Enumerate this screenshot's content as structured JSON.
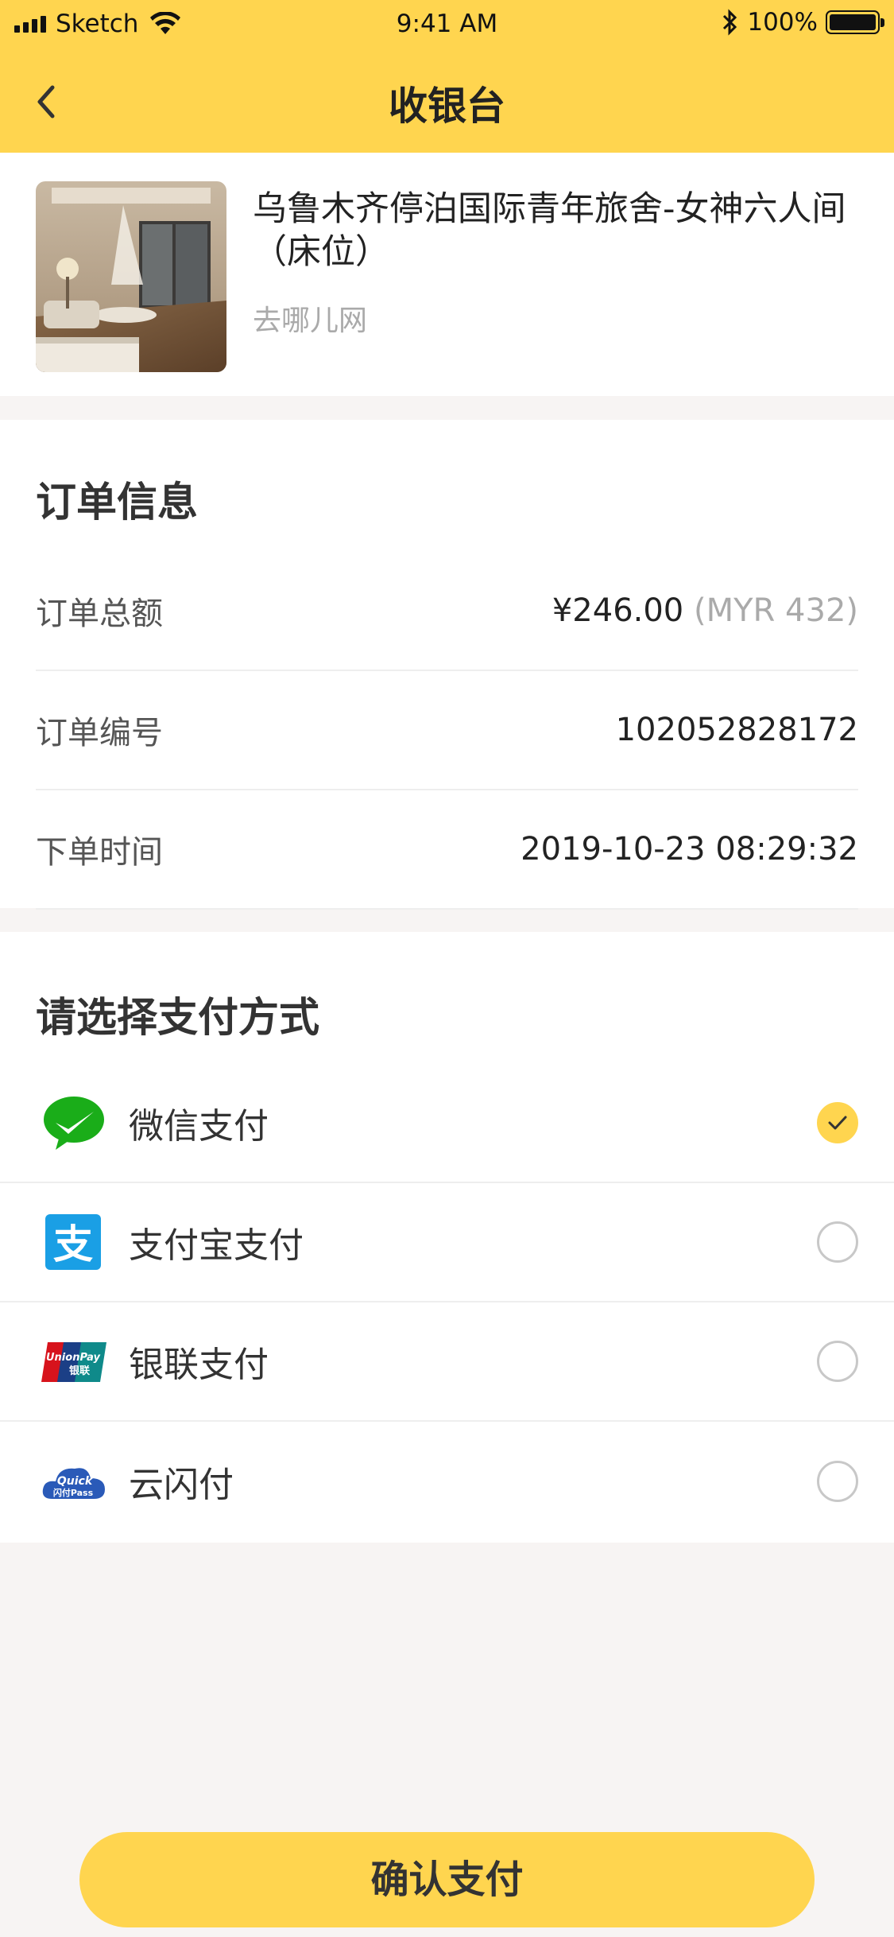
{
  "status_bar": {
    "carrier": "Sketch",
    "time": "9:41 AM",
    "battery": "100%"
  },
  "nav": {
    "title": "收银台",
    "back_icon": "chevron-left-icon"
  },
  "product": {
    "title": "乌鲁木齐停泊国际青年旅舍-女神六人间（床位）",
    "source": "去哪儿网",
    "image": "hostel-room-photo"
  },
  "order_info": {
    "title": "订单信息",
    "rows": [
      {
        "label": "订单总额",
        "value": "¥246.00",
        "sub": "(MYR 432)"
      },
      {
        "label": "订单编号",
        "value": "102052828172",
        "sub": ""
      },
      {
        "label": "下单时间",
        "value": "2019-10-23 08:29:32",
        "sub": ""
      }
    ]
  },
  "payment": {
    "title": "请选择支付方式",
    "methods": [
      {
        "label": "微信支付",
        "icon": "wechat-pay-icon",
        "selected": true
      },
      {
        "label": "支付宝支付",
        "icon": "alipay-icon",
        "selected": false
      },
      {
        "label": "银联支付",
        "icon": "unionpay-icon",
        "selected": false
      },
      {
        "label": "云闪付",
        "icon": "quickpass-icon",
        "selected": false
      }
    ]
  },
  "confirm_label": "确认支付",
  "colors": {
    "accent": "#ffd54f",
    "background": "#f7f4f3",
    "wechat": "#1aad19",
    "alipay": "#1a9fe5"
  }
}
